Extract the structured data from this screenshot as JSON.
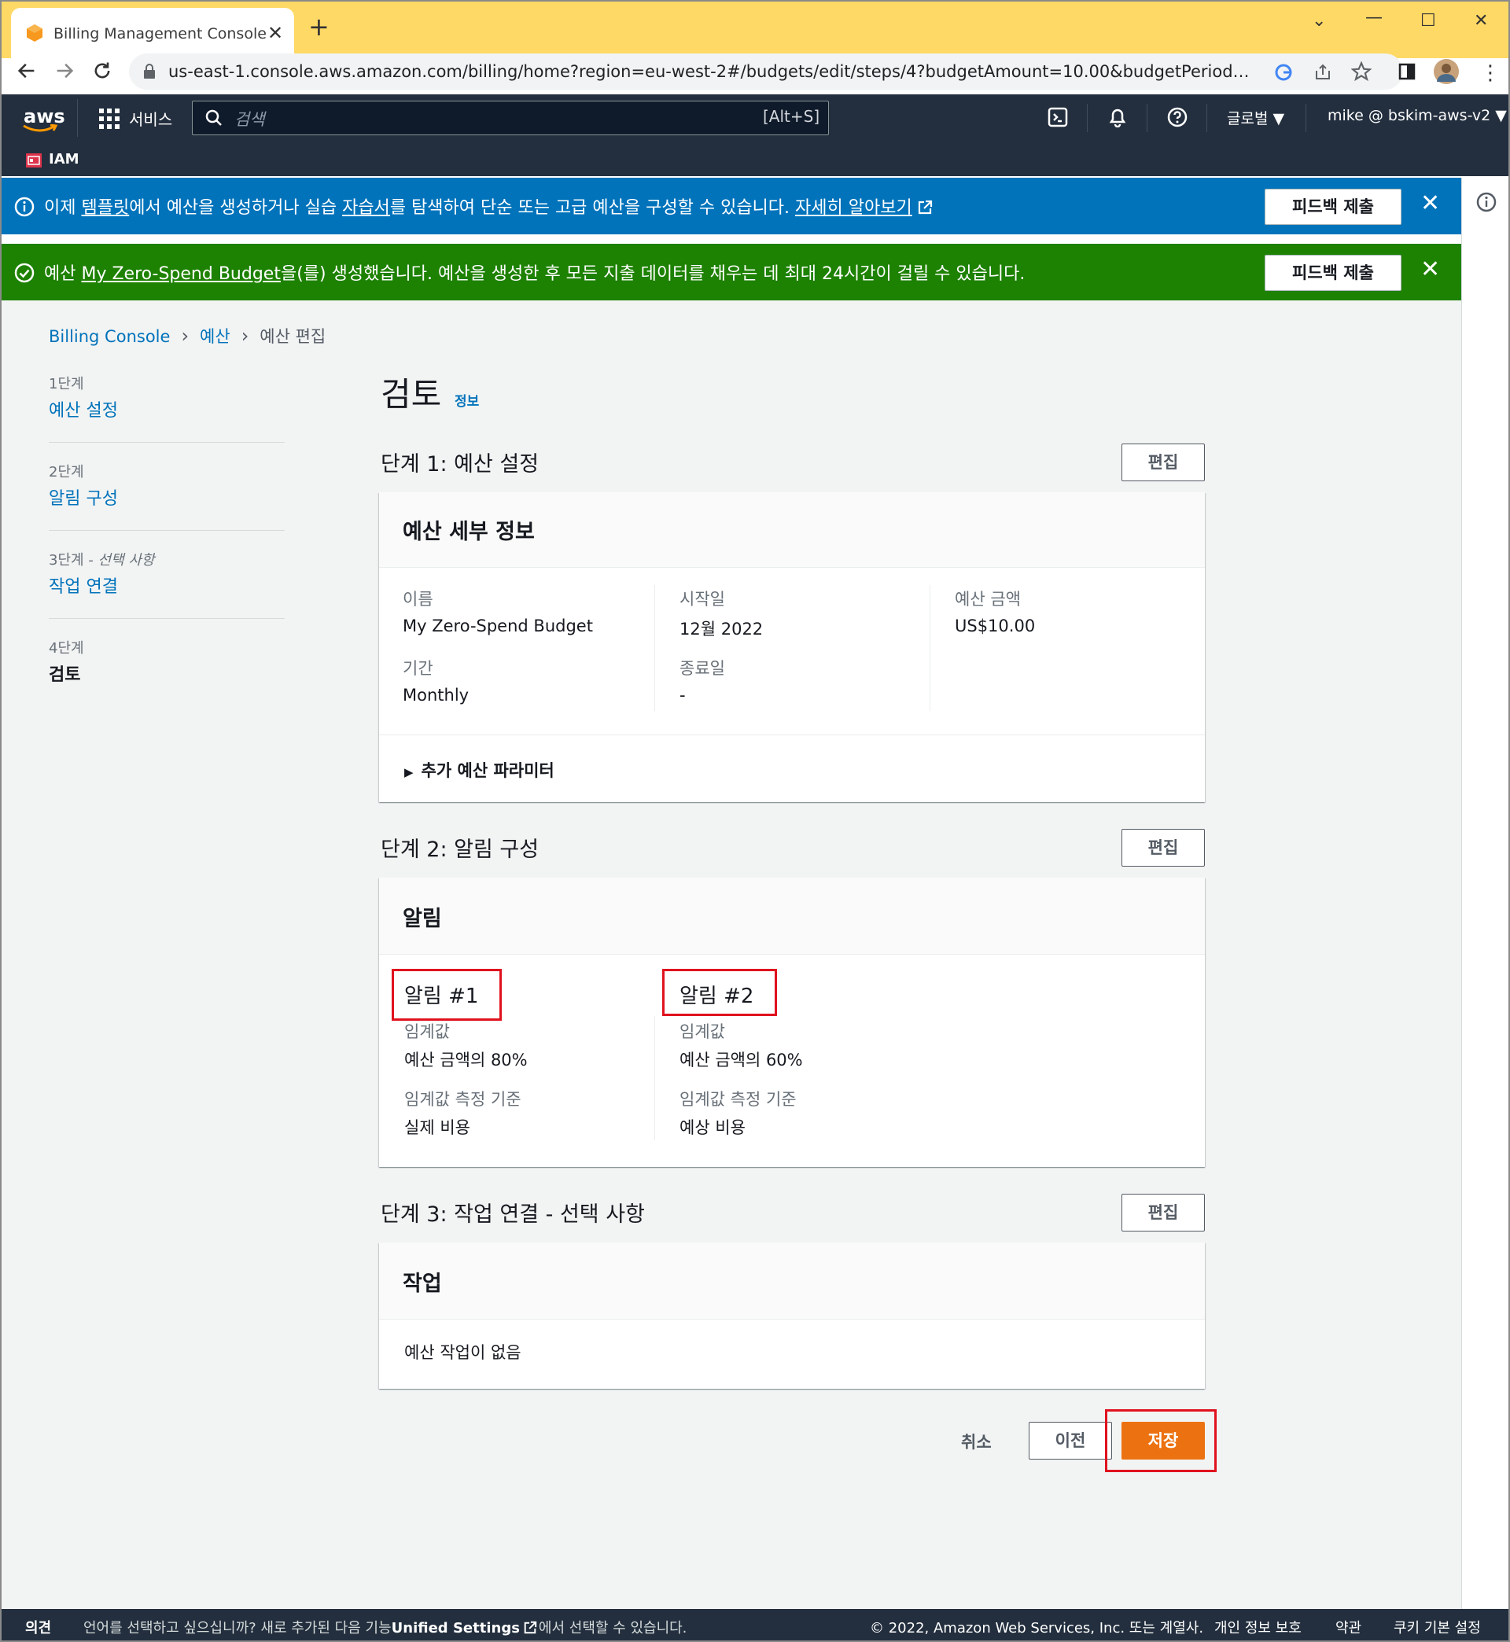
{
  "browser": {
    "tab_title": "Billing Management Console",
    "url": "us-east-1.console.aws.amazon.com/billing/home?region=eu-west-2#/budgets/edit/steps/4?budgetAmount=10.00&budgetPeriod=Monthly&bu..."
  },
  "aws_header": {
    "services_label": "서비스",
    "search_placeholder": "검색",
    "search_shortcut": "[Alt+S]",
    "region_label": "글로벌",
    "account_label": "mike @ bskim-aws-v2",
    "favorite_service": "IAM"
  },
  "flash_info": {
    "text_1": "이제 ",
    "link_templates": "템플릿",
    "text_2": "에서 예산을 생성하거나 실습 ",
    "link_tutorials": "자습서",
    "text_3": "를 탐색하여 단순 또는 고급 예산을 구성할 수 있습니다. ",
    "link_learn_more": "자세히 알아보기",
    "feedback_button": "피드백 제출"
  },
  "flash_success": {
    "text_1": "예산 ",
    "link_budget": "My Zero-Spend Budget",
    "text_2": "을(를) 생성했습니다. 예산을 생성한 후 모든 지출 데이터를 채우는 데 최대 24시간이 걸릴 수 있습니다.",
    "feedback_button": "피드백 제출"
  },
  "breadcrumb": {
    "item_1": "Billing Console",
    "item_2": "예산",
    "item_3": "예산 편집"
  },
  "steps": [
    {
      "num": "1단계",
      "label": "예산 설정"
    },
    {
      "num": "2단계",
      "label": "알림 구성"
    },
    {
      "num": "3단계",
      "num_suffix": " - 선택 사항",
      "label": "작업 연결"
    },
    {
      "num": "4단계",
      "label": "검토"
    }
  ],
  "page": {
    "title": "검토",
    "info_link": "정보"
  },
  "section_1": {
    "heading": "단계 1: 예산 설정",
    "edit_label": "편집",
    "card_title": "예산 세부 정보",
    "name_label": "이름",
    "name_value": "My Zero-Spend Budget",
    "period_label": "기간",
    "period_value": "Monthly",
    "start_label": "시작일",
    "start_value": "12월 2022",
    "end_label": "종료일",
    "end_value": "-",
    "amount_label": "예산 금액",
    "amount_value": "US$10.00",
    "expander_label": "추가 예산 파라미터"
  },
  "section_2": {
    "heading": "단계 2: 알림 구성",
    "edit_label": "편집",
    "card_title": "알림",
    "alarms": [
      {
        "title": "알림 #1",
        "threshold_label": "임계값",
        "threshold_value": "예산 금액의 80%",
        "basis_label": "임계값 측정 기준",
        "basis_value": "실제 비용"
      },
      {
        "title": "알림 #2",
        "threshold_label": "임계값",
        "threshold_value": "예산 금액의 60%",
        "basis_label": "임계값 측정 기준",
        "basis_value": "예상 비용"
      }
    ]
  },
  "section_3": {
    "heading": "단계 3: 작업 연결 - 선택 사항",
    "edit_label": "편집",
    "card_title": "작업",
    "empty_text": "예산 작업이 없음"
  },
  "actions": {
    "cancel": "취소",
    "previous": "이전",
    "save": "저장"
  },
  "footer": {
    "feedback": "의견",
    "language_text": "언어를 선택하고 싶으십니까? 새로 추가된 다음 기능",
    "unified_settings": "Unified Settings",
    "language_text_2": "에서 선택할 수 있습니다.",
    "copyright": "© 2022, Amazon Web Services, Inc. 또는 계열사.",
    "privacy": "개인 정보 보호",
    "terms": "약관",
    "cookies": "쿠키 기본 설정"
  },
  "colors": {
    "aws_nav": "#232f3e",
    "info_banner": "#0073bb",
    "success_banner": "#1d8102",
    "primary_button": "#ec7211",
    "highlight_box": "#e0121e"
  }
}
